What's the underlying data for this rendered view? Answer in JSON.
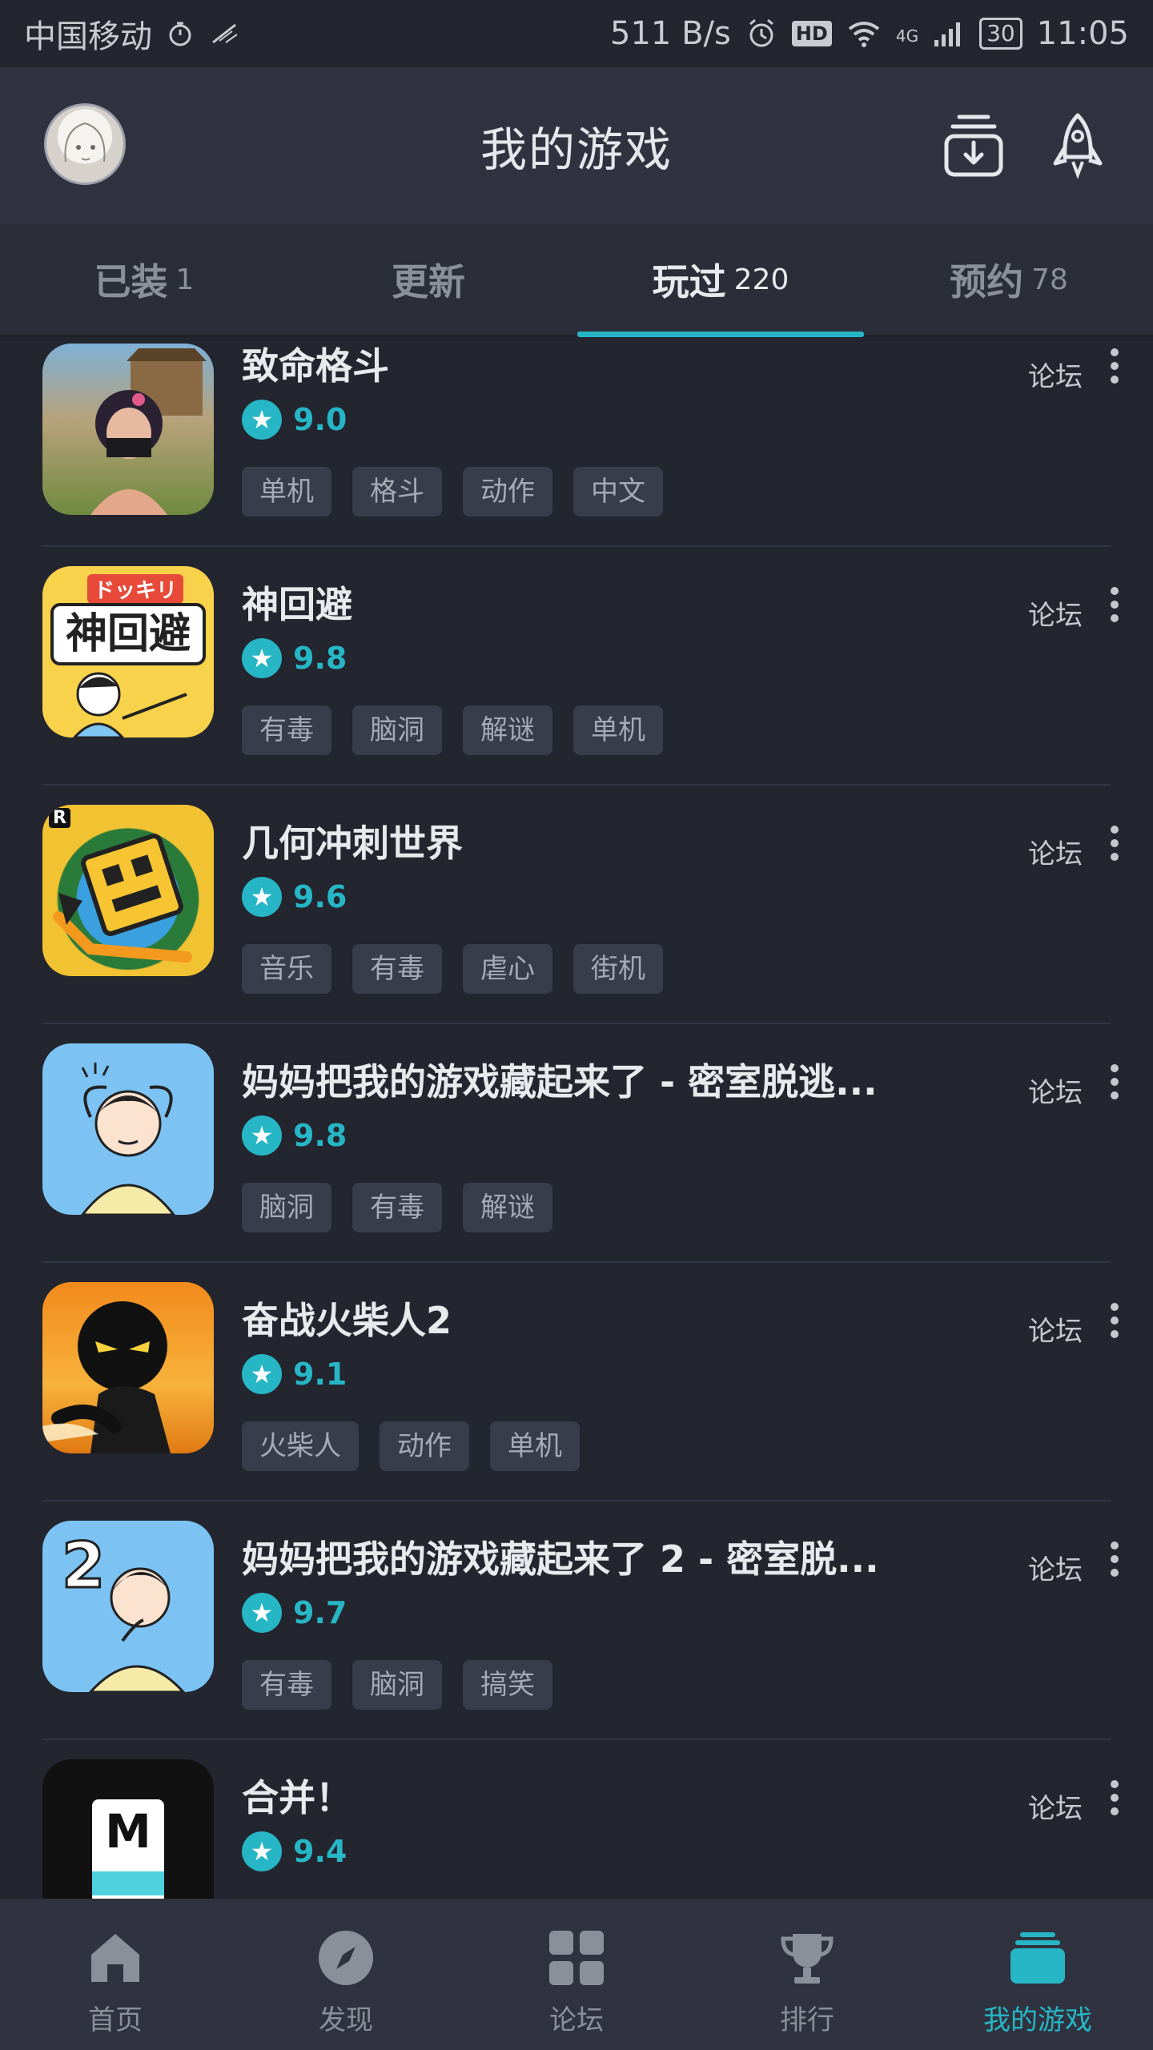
{
  "status_bar": {
    "carrier": "中国移动",
    "speed": "511 B/s",
    "hd_badge": "HD",
    "network": "4G",
    "battery": "30",
    "time": "11:05"
  },
  "header": {
    "title": "我的游戏"
  },
  "tabs": [
    {
      "label": "已装",
      "count": "1"
    },
    {
      "label": "更新",
      "count": ""
    },
    {
      "label": "玩过",
      "count": "220"
    },
    {
      "label": "预约",
      "count": "78"
    }
  ],
  "games": [
    {
      "name": "致命格斗",
      "score": "9.0",
      "tags": [
        "单机",
        "格斗",
        "动作",
        "中文"
      ],
      "forum": "论坛"
    },
    {
      "name": "神回避",
      "score": "9.8",
      "tags": [
        "有毒",
        "脑洞",
        "解谜",
        "单机"
      ],
      "forum": "论坛",
      "icon_text_top": "ドッキリ",
      "icon_text_main": "神回避"
    },
    {
      "name": "几何冲刺世界",
      "score": "9.6",
      "tags": [
        "音乐",
        "有毒",
        "虐心",
        "街机"
      ],
      "forum": "论坛",
      "icon_badge": "R"
    },
    {
      "name": "妈妈把我的游戏藏起来了 - 密室脱逃...",
      "score": "9.8",
      "tags": [
        "脑洞",
        "有毒",
        "解谜"
      ],
      "forum": "论坛"
    },
    {
      "name": "奋战火柴人2",
      "score": "9.1",
      "tags": [
        "火柴人",
        "动作",
        "单机"
      ],
      "forum": "论坛"
    },
    {
      "name": "妈妈把我的游戏藏起来了 2 - 密室脱...",
      "score": "9.7",
      "tags": [
        "有毒",
        "脑洞",
        "搞笑"
      ],
      "forum": "论坛",
      "icon_number": "2"
    },
    {
      "name": "合并！",
      "score": "9.4",
      "tags": [],
      "forum": "论坛",
      "icon_letter": "M"
    }
  ],
  "bottom_nav": [
    {
      "label": "首页",
      "icon": "home-icon"
    },
    {
      "label": "发现",
      "icon": "compass-icon"
    },
    {
      "label": "论坛",
      "icon": "grid-icon"
    },
    {
      "label": "排行",
      "icon": "trophy-icon"
    },
    {
      "label": "我的游戏",
      "icon": "stack-icon"
    }
  ],
  "colors": {
    "accent": "#26b6c5",
    "background": "#23252f",
    "header": "#30333f"
  }
}
